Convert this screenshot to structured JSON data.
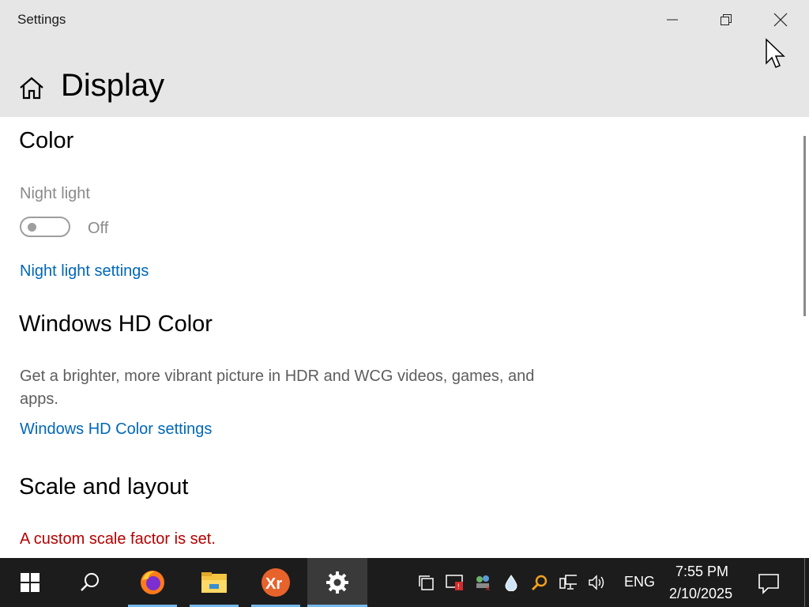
{
  "window": {
    "app_title": "Settings",
    "page_title": "Display",
    "controls": [
      "minimize-icon",
      "restore-icon",
      "close-icon"
    ]
  },
  "color_section": {
    "heading": "Color",
    "night_light_label": "Night light",
    "night_light_state": "Off",
    "night_light_on": false,
    "night_light_settings_link": "Night light settings"
  },
  "hd_color_section": {
    "heading": "Windows HD Color",
    "description": "Get a brighter, more vibrant picture in HDR and WCG videos, games, and apps.",
    "settings_link": "Windows HD Color settings"
  },
  "scale_section": {
    "heading": "Scale and layout",
    "warning": "A custom scale factor is set."
  },
  "taskbar": {
    "language": "ENG",
    "time": "7:55 PM",
    "date": "2/10/2025",
    "pinned_apps": [
      "firefox-icon",
      "file-explorer-icon",
      "xr-app-icon",
      "settings-gear-icon"
    ],
    "active_app": "settings-gear-icon",
    "tray_icons": [
      "task-view-icon",
      "security-alert-icon",
      "network-people-icon",
      "water-drop-icon",
      "search-tool-icon",
      "network-icon",
      "volume-icon"
    ]
  },
  "colors": {
    "accent_link": "#0067b8",
    "warning_text": "#b40000",
    "titlebar_bg": "#e6e6e6",
    "taskbar_bg": "#1c1c1c"
  }
}
